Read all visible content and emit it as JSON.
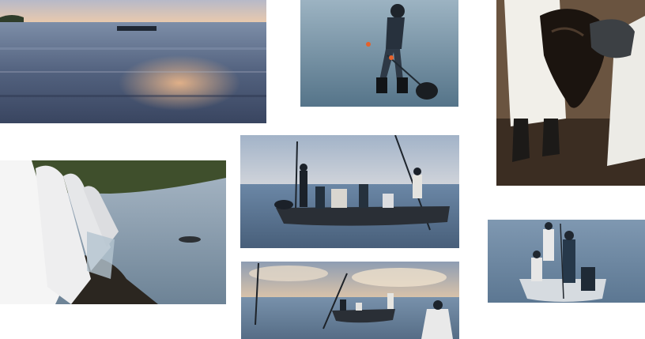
{
  "collage": {
    "background": "#ffffff",
    "photos": [
      {
        "subject": "calm-sea-at-sunset-with-boat",
        "palette": [
          "#a7b4c9",
          "#e3b48a",
          "#3c4a66"
        ]
      },
      {
        "subject": "worker-in-boots-fishing-oil-from-shallow-water",
        "palette": [
          "#6f8fa6",
          "#2d3b4a"
        ]
      },
      {
        "subject": "gloved-hands-holding-oil-soaked-material",
        "palette": [
          "#f3f1ec",
          "#1d1612",
          "#6b4f3a"
        ]
      },
      {
        "subject": "workers-in-white-protective-suits-on-shore",
        "palette": [
          "#f7f7f7",
          "#8ea3b6",
          "#2f3a26"
        ]
      },
      {
        "subject": "crew-in-wooden-boat-with-poles",
        "palette": [
          "#8fa6c4",
          "#2a3340",
          "#d9d2c7"
        ]
      },
      {
        "subject": "workers-in-small-boat",
        "palette": [
          "#6e8aa6",
          "#d8dde2",
          "#2c3a48"
        ]
      },
      {
        "subject": "boat-at-sea-with-cloudy-sunset-sky",
        "palette": [
          "#c9b7a2",
          "#7b93ad",
          "#2b3038"
        ]
      }
    ]
  }
}
